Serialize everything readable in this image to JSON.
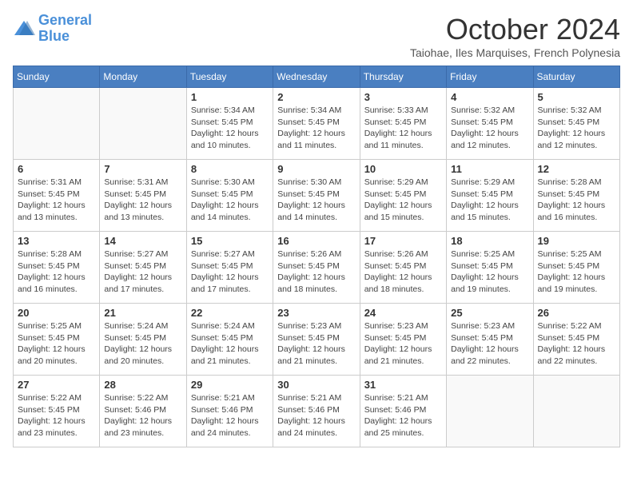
{
  "header": {
    "logo_line1": "General",
    "logo_line2": "Blue",
    "month_title": "October 2024",
    "subtitle": "Taiohae, Iles Marquises, French Polynesia"
  },
  "days_of_week": [
    "Sunday",
    "Monday",
    "Tuesday",
    "Wednesday",
    "Thursday",
    "Friday",
    "Saturday"
  ],
  "weeks": [
    [
      {
        "day": "",
        "info": ""
      },
      {
        "day": "",
        "info": ""
      },
      {
        "day": "1",
        "info": "Sunrise: 5:34 AM\nSunset: 5:45 PM\nDaylight: 12 hours and 10 minutes."
      },
      {
        "day": "2",
        "info": "Sunrise: 5:34 AM\nSunset: 5:45 PM\nDaylight: 12 hours and 11 minutes."
      },
      {
        "day": "3",
        "info": "Sunrise: 5:33 AM\nSunset: 5:45 PM\nDaylight: 12 hours and 11 minutes."
      },
      {
        "day": "4",
        "info": "Sunrise: 5:32 AM\nSunset: 5:45 PM\nDaylight: 12 hours and 12 minutes."
      },
      {
        "day": "5",
        "info": "Sunrise: 5:32 AM\nSunset: 5:45 PM\nDaylight: 12 hours and 12 minutes."
      }
    ],
    [
      {
        "day": "6",
        "info": "Sunrise: 5:31 AM\nSunset: 5:45 PM\nDaylight: 12 hours and 13 minutes."
      },
      {
        "day": "7",
        "info": "Sunrise: 5:31 AM\nSunset: 5:45 PM\nDaylight: 12 hours and 13 minutes."
      },
      {
        "day": "8",
        "info": "Sunrise: 5:30 AM\nSunset: 5:45 PM\nDaylight: 12 hours and 14 minutes."
      },
      {
        "day": "9",
        "info": "Sunrise: 5:30 AM\nSunset: 5:45 PM\nDaylight: 12 hours and 14 minutes."
      },
      {
        "day": "10",
        "info": "Sunrise: 5:29 AM\nSunset: 5:45 PM\nDaylight: 12 hours and 15 minutes."
      },
      {
        "day": "11",
        "info": "Sunrise: 5:29 AM\nSunset: 5:45 PM\nDaylight: 12 hours and 15 minutes."
      },
      {
        "day": "12",
        "info": "Sunrise: 5:28 AM\nSunset: 5:45 PM\nDaylight: 12 hours and 16 minutes."
      }
    ],
    [
      {
        "day": "13",
        "info": "Sunrise: 5:28 AM\nSunset: 5:45 PM\nDaylight: 12 hours and 16 minutes."
      },
      {
        "day": "14",
        "info": "Sunrise: 5:27 AM\nSunset: 5:45 PM\nDaylight: 12 hours and 17 minutes."
      },
      {
        "day": "15",
        "info": "Sunrise: 5:27 AM\nSunset: 5:45 PM\nDaylight: 12 hours and 17 minutes."
      },
      {
        "day": "16",
        "info": "Sunrise: 5:26 AM\nSunset: 5:45 PM\nDaylight: 12 hours and 18 minutes."
      },
      {
        "day": "17",
        "info": "Sunrise: 5:26 AM\nSunset: 5:45 PM\nDaylight: 12 hours and 18 minutes."
      },
      {
        "day": "18",
        "info": "Sunrise: 5:25 AM\nSunset: 5:45 PM\nDaylight: 12 hours and 19 minutes."
      },
      {
        "day": "19",
        "info": "Sunrise: 5:25 AM\nSunset: 5:45 PM\nDaylight: 12 hours and 19 minutes."
      }
    ],
    [
      {
        "day": "20",
        "info": "Sunrise: 5:25 AM\nSunset: 5:45 PM\nDaylight: 12 hours and 20 minutes."
      },
      {
        "day": "21",
        "info": "Sunrise: 5:24 AM\nSunset: 5:45 PM\nDaylight: 12 hours and 20 minutes."
      },
      {
        "day": "22",
        "info": "Sunrise: 5:24 AM\nSunset: 5:45 PM\nDaylight: 12 hours and 21 minutes."
      },
      {
        "day": "23",
        "info": "Sunrise: 5:23 AM\nSunset: 5:45 PM\nDaylight: 12 hours and 21 minutes."
      },
      {
        "day": "24",
        "info": "Sunrise: 5:23 AM\nSunset: 5:45 PM\nDaylight: 12 hours and 21 minutes."
      },
      {
        "day": "25",
        "info": "Sunrise: 5:23 AM\nSunset: 5:45 PM\nDaylight: 12 hours and 22 minutes."
      },
      {
        "day": "26",
        "info": "Sunrise: 5:22 AM\nSunset: 5:45 PM\nDaylight: 12 hours and 22 minutes."
      }
    ],
    [
      {
        "day": "27",
        "info": "Sunrise: 5:22 AM\nSunset: 5:45 PM\nDaylight: 12 hours and 23 minutes."
      },
      {
        "day": "28",
        "info": "Sunrise: 5:22 AM\nSunset: 5:46 PM\nDaylight: 12 hours and 23 minutes."
      },
      {
        "day": "29",
        "info": "Sunrise: 5:21 AM\nSunset: 5:46 PM\nDaylight: 12 hours and 24 minutes."
      },
      {
        "day": "30",
        "info": "Sunrise: 5:21 AM\nSunset: 5:46 PM\nDaylight: 12 hours and 24 minutes."
      },
      {
        "day": "31",
        "info": "Sunrise: 5:21 AM\nSunset: 5:46 PM\nDaylight: 12 hours and 25 minutes."
      },
      {
        "day": "",
        "info": ""
      },
      {
        "day": "",
        "info": ""
      }
    ]
  ]
}
